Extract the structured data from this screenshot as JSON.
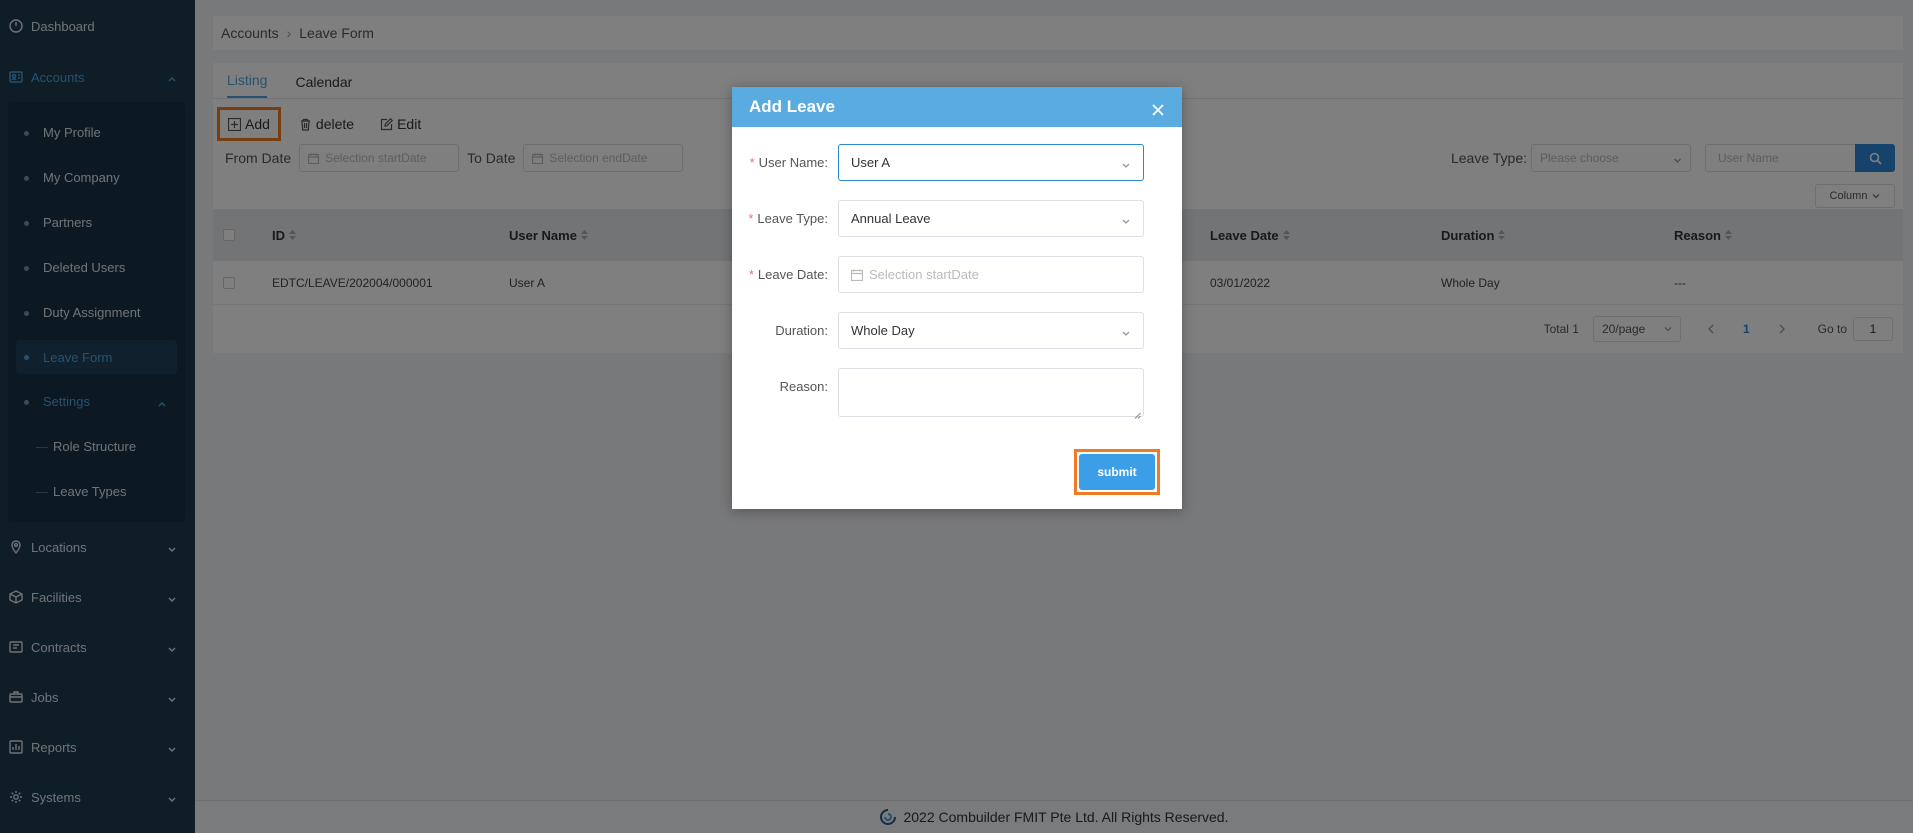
{
  "sidebar": {
    "dashboard": "Dashboard",
    "accounts": "Accounts",
    "account_items": [
      {
        "label": "My Profile"
      },
      {
        "label": "My Company"
      },
      {
        "label": "Partners"
      },
      {
        "label": "Deleted Users"
      },
      {
        "label": "Duty Assignment"
      },
      {
        "label": "Leave Form"
      }
    ],
    "settings": "Settings",
    "settings_items": [
      {
        "label": "Role Structure"
      },
      {
        "label": "Leave Types"
      }
    ],
    "sections": [
      {
        "label": "Locations",
        "icon": "location-icon"
      },
      {
        "label": "Facilities",
        "icon": "facilities-icon"
      },
      {
        "label": "Contracts",
        "icon": "contracts-icon"
      },
      {
        "label": "Jobs",
        "icon": "jobs-icon"
      },
      {
        "label": "Reports",
        "icon": "reports-icon"
      },
      {
        "label": "Systems",
        "icon": "systems-icon"
      }
    ]
  },
  "breadcrumb": {
    "root": "Accounts",
    "current": "Leave Form"
  },
  "tabs": {
    "listing": "Listing",
    "calendar": "Calendar"
  },
  "toolbar": {
    "add": "Add",
    "delete": "delete",
    "edit": "Edit"
  },
  "filters": {
    "from_label": "From Date",
    "from_placeholder": "Selection startDate",
    "to_label": "To Date",
    "to_placeholder": "Selection endDate",
    "leave_type_label": "Leave Type:",
    "leave_type_placeholder": "Please choose",
    "user_name_placeholder": "User Name",
    "column_button": "Column"
  },
  "table": {
    "headers": [
      "ID",
      "User Name",
      "Leave Date",
      "Duration",
      "Reason"
    ],
    "rows": [
      {
        "id": "EDTC/LEAVE/202004/000001",
        "user": "User A",
        "date": "03/01/2022",
        "duration": "Whole Day",
        "reason": "---"
      }
    ]
  },
  "pager": {
    "total": "Total 1",
    "page_size": "20/page",
    "current": "1",
    "goto_label": "Go to",
    "goto_value": "1"
  },
  "footer": {
    "text": "2022 Combuilder FMIT Pte Ltd. All Rights Reserved."
  },
  "modal": {
    "title": "Add Leave",
    "user_name_label": "User Name:",
    "user_name_value": "User A",
    "leave_type_label": "Leave Type:",
    "leave_type_value": "Annual Leave",
    "leave_date_label": "Leave Date:",
    "leave_date_placeholder": "Selection startDate",
    "duration_label": "Duration:",
    "duration_value": "Whole Day",
    "reason_label": "Reason:",
    "required_mark": "*",
    "submit": "submit"
  },
  "colors": {
    "sidebar_bg": "#1f3a4f",
    "accent": "#4da3e0",
    "modal_header": "#5aabdf",
    "highlight": "#f27a24",
    "submit": "#3d9ee8"
  }
}
